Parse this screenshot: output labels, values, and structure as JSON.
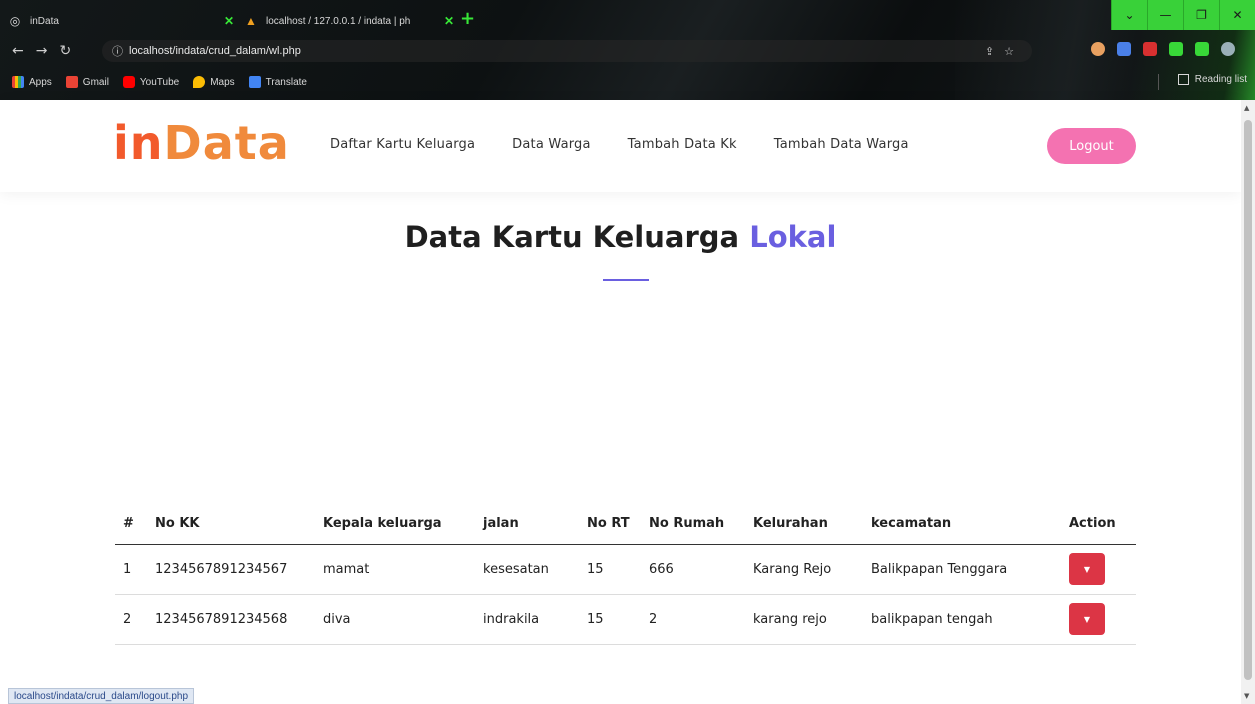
{
  "browser": {
    "tabs": [
      {
        "title": "inData",
        "icon": "globe-icon"
      },
      {
        "title": "localhost / 127.0.0.1 / indata | ph",
        "icon": "phpmyadmin-icon"
      }
    ],
    "url": "localhost/indata/crud_dalam/wl.php",
    "bookmarks": [
      "Apps",
      "Gmail",
      "YouTube",
      "Maps",
      "Translate"
    ],
    "reading_list": "Reading list",
    "status_url": "localhost/indata/crud_dalam/logout.php"
  },
  "site": {
    "logo_part1": "in",
    "logo_part2": "Data",
    "nav": [
      "Daftar Kartu Keluarga",
      "Data Warga",
      "Tambah Data Kk",
      "Tambah Data Warga"
    ],
    "logout": "Logout"
  },
  "heading": {
    "main": "Data Kartu Keluarga",
    "accent": "Lokal"
  },
  "table": {
    "columns": [
      "#",
      "No KK",
      "Kepala keluarga",
      "jalan",
      "No RT",
      "No Rumah",
      "Kelurahan",
      "kecamatan",
      "Action"
    ],
    "rows": [
      [
        "1",
        "1234567891234567",
        "mamat",
        "kesesatan",
        "15",
        "666",
        "Karang Rejo",
        "Balikpapan Tenggara"
      ],
      [
        "2",
        "1234567891234568",
        "diva",
        "indrakila",
        "15",
        "2",
        "karang rejo",
        "balikpapan tengah"
      ]
    ]
  },
  "colors": {
    "accent": "#6a5fe0",
    "logout_bg": "#f472b1",
    "action_btn": "#dc3545",
    "logo_in": "#f25a2c",
    "logo_data": "#f08a3c"
  }
}
